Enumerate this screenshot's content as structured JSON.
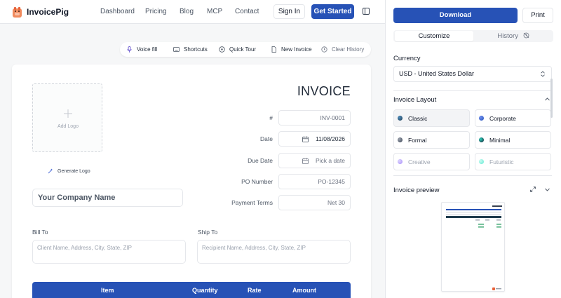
{
  "brand": {
    "name": "InvoicePig"
  },
  "nav": {
    "links": [
      "Dashboard",
      "Pricing",
      "Blog",
      "MCP",
      "Contact"
    ],
    "sign_in": "Sign In",
    "get_started": "Get Started"
  },
  "toolbar": {
    "voice_fill": "Voice fill",
    "shortcuts": "Shortcuts",
    "quick_tour": "Quick Tour",
    "new_invoice": "New Invoice",
    "clear_history": "Clear History"
  },
  "invoice": {
    "title": "INVOICE",
    "add_logo": "Add Logo",
    "generate_logo": "Generate Logo",
    "company_placeholder": "Your Company Name",
    "fields": {
      "number_label": "#",
      "number_value": "INV-0001",
      "date_label": "Date",
      "date_value": "11/08/2026",
      "due_date_label": "Due Date",
      "due_date_placeholder": "Pick a date",
      "po_label": "PO Number",
      "po_placeholder": "PO-12345",
      "terms_label": "Payment Terms",
      "terms_placeholder": "Net 30"
    },
    "bill_to": {
      "label": "Bill To",
      "placeholder": "Client Name, Address, City, State, ZIP"
    },
    "ship_to": {
      "label": "Ship To",
      "placeholder": "Recipient Name, Address, City, State, ZIP"
    },
    "table_headers": [
      "Item",
      "Quantity",
      "Rate",
      "Amount"
    ]
  },
  "panel": {
    "download": "Download",
    "print": "Print",
    "tabs": [
      "Customize",
      "History"
    ],
    "currency_label": "Currency",
    "currency_value": "USD - United States Dollar",
    "layout_label": "Invoice Layout",
    "layouts": [
      {
        "name": "Classic",
        "color": "#1f3b4d"
      },
      {
        "name": "Corporate",
        "color": "#2752b6"
      },
      {
        "name": "Formal",
        "color": "#374151"
      },
      {
        "name": "Minimal",
        "color": "#0f766e"
      },
      {
        "name": "Creative",
        "color": "#a78bfa"
      },
      {
        "name": "Futuristic",
        "color": "#5eead4"
      }
    ],
    "preview_label": "Invoice preview"
  },
  "colors": {
    "accent": "#2752b6",
    "brand_orange": "#e8623a"
  }
}
